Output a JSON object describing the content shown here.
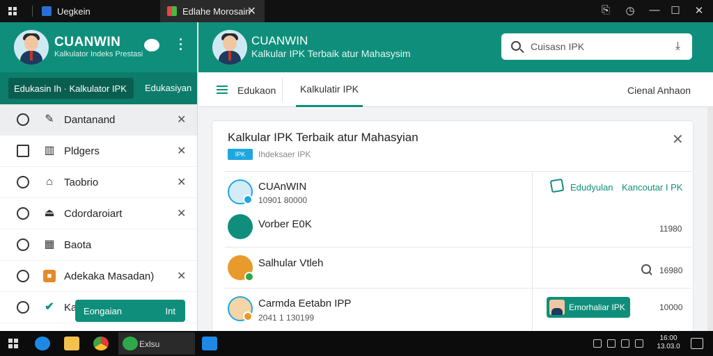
{
  "titlebar": {
    "tabs": [
      {
        "label": "Uegkein"
      },
      {
        "label": "Edlahe Morosain"
      }
    ],
    "controls": [
      "share-icon",
      "history-icon",
      "minimize-icon",
      "maximize-icon",
      "close-icon"
    ]
  },
  "sidebar": {
    "brand": "CUANWIN",
    "subtitle": "Kalkulator Indeks Prestasi",
    "tabs": {
      "active": "Edukasin Ih · Kalkulator IPK",
      "other": "Edukasiyan"
    },
    "items": [
      {
        "label": "Dantanand",
        "icon": "clock-icon",
        "icon2": "pin-icon",
        "closable": true,
        "selected": true
      },
      {
        "label": "Pldgers",
        "icon": "card-icon",
        "icon2": "building-icon",
        "closable": true
      },
      {
        "label": "Taobrio",
        "icon": "help-icon",
        "icon2": "trash-icon",
        "closable": true
      },
      {
        "label": "Cdordaroiart",
        "icon": "search-icon",
        "icon2": "eject-icon",
        "closable": true
      },
      {
        "label": "Baota",
        "icon": "help-icon",
        "icon2": "calculator-icon",
        "closable": false
      },
      {
        "label": "Adekaka Masadan)",
        "icon": "help-icon",
        "icon2": "orange-app-icon",
        "closable": true
      },
      {
        "label": "Ka",
        "icon": "help-icon",
        "icon2": "check-icon",
        "closable": false
      }
    ],
    "bottom_button": {
      "label": "Eongaian",
      "sub": "Int"
    }
  },
  "header": {
    "title": "CUANWIN",
    "subtitle": "Kalkular IPK Terbaik atur Mahasysim",
    "search": {
      "placeholder": "Cuisasn IPK"
    }
  },
  "nav": {
    "tabs": [
      "Edukaon",
      "Kalkulatir IPK"
    ],
    "active": "Kalkulatir IPK",
    "right_link": "Cienal Anhaon"
  },
  "card": {
    "title": "Kalkular IPK Terbaik atur Mahasyian",
    "badge": "IPK",
    "badge_label": "Ihdeksaer IPK",
    "rows": [
      {
        "title": "CUAnWIN",
        "subtitle": "10901 80000",
        "icon": "compass-icon"
      },
      {
        "title": "Vorber E0K",
        "subtitle": "",
        "icon": "chat-icon"
      },
      {
        "title": "Salhular Vtleh",
        "subtitle": "",
        "icon": "coin-icon"
      },
      {
        "title": "Carmda Eetabn IPP",
        "subtitle": "2041 1 130199",
        "icon": "person-icon"
      }
    ],
    "right": {
      "status_label": "Edudyulan",
      "status_value": "Kancoutar I PK",
      "values": [
        "11980",
        "16980",
        "10000"
      ],
      "rate_button": "Emorhaliar IPK"
    }
  },
  "taskbar": {
    "active_label": "Exlsu",
    "clock": [
      "16:00",
      "13.03.0"
    ],
    "apps": [
      "windows-start-icon",
      "browser-icon",
      "folder-icon",
      "chrome-icon",
      "app-icon",
      "mail-icon"
    ]
  },
  "colors": {
    "primary": "#0f8f7b",
    "primary_dark": "#0d7c6a",
    "accent_blue": "#1ea7df",
    "taskbar": "#0c0c0c"
  }
}
